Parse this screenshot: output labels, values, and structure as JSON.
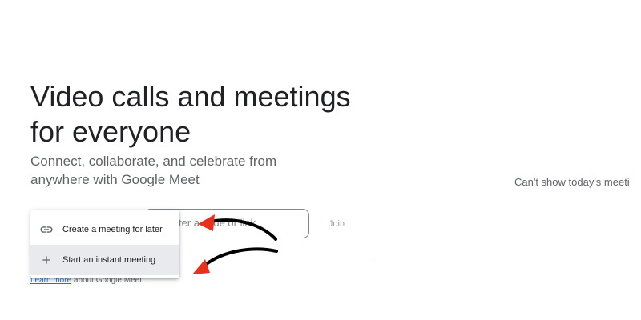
{
  "hero": {
    "title": "Video calls and meetings for everyone",
    "subtitle": "Connect, collaborate, and celebrate from anywhere with Google Meet"
  },
  "join": {
    "placeholder_visible": "ter a code or link",
    "button_label": "Join"
  },
  "learn_more": {
    "link_text": "Learn more",
    "rest_text": " about Google Meet"
  },
  "new_meeting_menu": {
    "items": [
      {
        "label": "Create a meeting for later",
        "icon": "link-icon"
      },
      {
        "label": "Start an instant meeting",
        "icon": "plus-icon"
      }
    ]
  },
  "calendar": {
    "message": "Can't show today's meeti"
  },
  "colors": {
    "annotation_arrow": "#000000",
    "annotation_arrowhead": "#e8301c"
  }
}
